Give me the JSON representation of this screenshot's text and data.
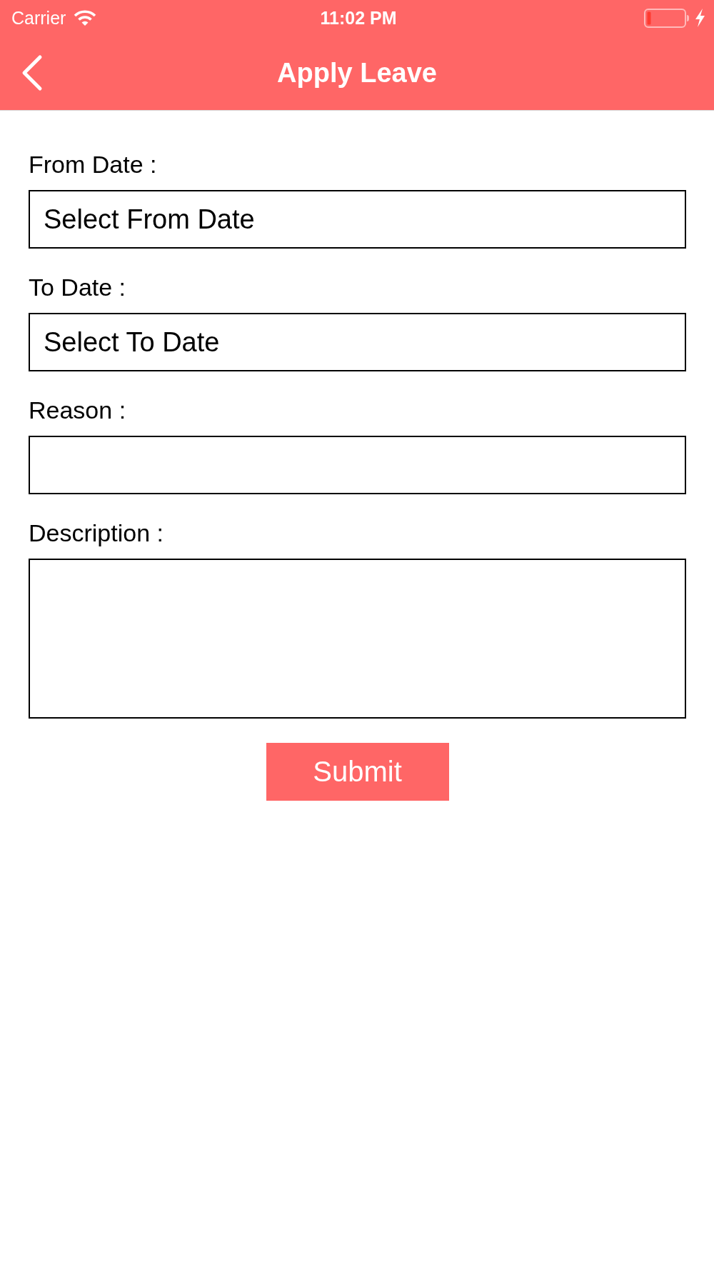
{
  "status_bar": {
    "carrier": "Carrier",
    "time": "11:02 PM"
  },
  "nav_bar": {
    "title": "Apply Leave"
  },
  "form": {
    "fields": [
      {
        "kind": "date",
        "label": "From Date :",
        "placeholder": "Select From Date"
      },
      {
        "kind": "date",
        "label": "To Date :",
        "placeholder": "Select To Date"
      },
      {
        "kind": "text",
        "label": "Reason :"
      },
      {
        "kind": "textarea",
        "label": "Description :"
      }
    ],
    "submit_button": "Submit"
  }
}
